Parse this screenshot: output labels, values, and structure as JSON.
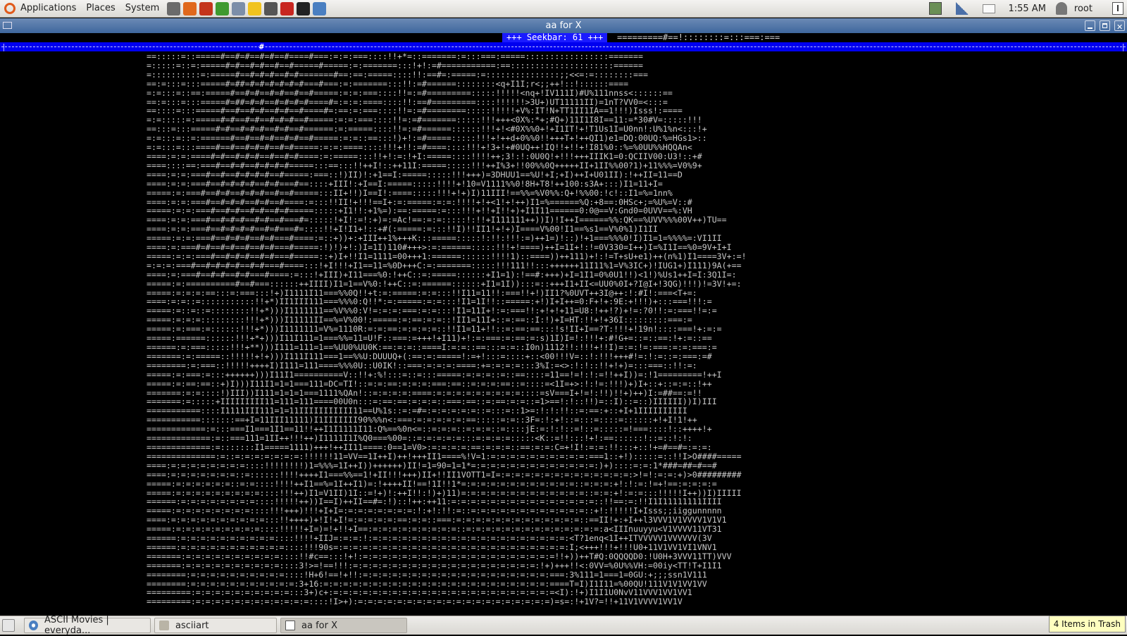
{
  "top_panel": {
    "menus": [
      "Applications",
      "Places",
      "System"
    ],
    "launchers": [
      {
        "icon": "evolution-icon",
        "color": "#6b6b6b"
      },
      {
        "icon": "firefox-icon",
        "color": "#e0681c"
      },
      {
        "icon": "tools-icon",
        "color": "#c4341b"
      },
      {
        "icon": "refresh-icon",
        "color": "#3f9a2f"
      },
      {
        "icon": "network-icon",
        "color": "#7c8ea8"
      },
      {
        "icon": "smiley-icon",
        "color": "#f1c31e"
      },
      {
        "icon": "text-editor-icon",
        "color": "#555555"
      },
      {
        "icon": "filezilla-icon",
        "color": "#c8261f"
      },
      {
        "icon": "terminal-icon",
        "color": "#222222"
      },
      {
        "icon": "chromium-icon",
        "color": "#4a7fc1"
      }
    ],
    "clock": "1:55 AM",
    "user": "root"
  },
  "window": {
    "title": "aa for X"
  },
  "terminal": {
    "status_left": "::::::::=========#=#=#==#=#==#======:=:===:::::!+*)+!:==#",
    "seekbar_label": "+++ Seekbar: 61 +++",
    "status_right": "=========#==!::::::::=:::===:===",
    "seekbar_percent": 23,
    "ascii_lines": [
      "==:::::=::=====#==#=#==#=#==#====#===:=:=:===::::!!+*=::=======:=:::===:=====:::::::::::::::::=======",
      "=:::::=::=:=====#=#==#=#==#==#=====#=====:=:=======:::!+!:=#===========:==:::::::::::::::::::::======",
      "=::::::::::=:=====#==#=#=#==#=#=======#==:==:=====::::!!:==#=:=====:=:::::::::::::::;;<<=:=::::::::===",
      "==:=:::=:::=====#=##=#=#=#=#=#=#===#===:=:=======:::!!:=#======::::::::<q+I1I;r<;;++!::!::::::====",
      "=:=:::=::==:=====#==#=#==#=#==#==#=====:=:=:===::::!!=:=#=========:::::!!!!!<nq+!IV111I)#U%111nnss<::::::==",
      "==:=:::=:::=====#=##=#=#==#=#=#=#====#=:=:=:====::::!!:==#=========::::!!!!!!>3U+)UT11111II)=1nT?VV0=<:::=",
      "==::::=:::=====#==#==#=#==#=#==#====#=:==:=:===::::!!=:=#========:::::!!!!!+V%:IT!N+TT1II1IA==1!!!)Isss!:====",
      "=:=:::::=:=====#=#==#=#==#=#=#==#=====:=:=:===::::!!=:=#=======:::::!!!+++<0X%:*+;#Q+)11I1I8I==11:=*30#V=:::::!!!",
      "==:::=:::=====#=#==#=#=#==#=#==#======:=:=====::::!!=:=#======::::::!!!+!<#0X%%0+!+I1IT!+!T1Us1I=U0nn!:U%1%n<:::!+",
      "=:=:::=::=:======#==#==#=#==#=#==#=====:=:=::==:::!)+!:=#=====:::::!!!+!++d+0%%0!!+++T+!++QI1)e1=DQ:00UQ:%=HGs1>::",
      "=:=:::=:::====#==#==#=#=#==#=#=====:=:=:====::::!!!+!!:=#====::::!!!+!3+!+#0UQ++!IQ!!+!!+!I81%0::%=%0UU%%HQQAn<",
      "====:=:=:====#=#==#=#=#==#==#=#====:=:=====:::!!+!:=:!+I:=====::::!!!!++;3!:!:0U0Q!+!!!+++IIIK1=0:QCIIV00:U3!::+#",
      "====::::==:===#==#=#==#=#=#=#=====:::==:::!!++I!::++11I:=====:::::!!!++I%3+!!00%%0Q+++++II+1II%%00?1)+11%%%=V0%9+",
      "====:=:=:===#==#==#=#=#=#==#=====:===::!)II)!:+1==I:=====:::::!!!+++)=3DHUU1==%U!+I;+I)++I+U01II):!++II=11==D",
      "====:=:=:===#==#=#=#=#==#=#===#==::::+III!:+I==I:=====:::::!!!!+!10=V1111%%0!8H+T8!++100:s3A+:::)I1=11+I=",
      "=====:=:===#==#=#==#=#=#==#==#=====:::II+!!)I==I!:====:::::!!!+!+)I)11III!==%%=%V0%%:Q+!%%00:!c!::I1=%=1nn%",
      "====:=:=:===#==#=#=#==#=#==#====:=:::!!II!+!!!==I+:=:=====:=:=:!!!!+!+<1!+!++)I1=%======%Q:+8==:0HSc+;=%U%=V::#",
      "=====:=:=:===#==#=#==#=#==#=#=====:::::+I1!!:+1%=):==:=====:=:::!!!+!!+I!!+)+I1I11======0:0@==V:Gnd0=0UVV==%:VH",
      "====:=:=:===#==#=#=#==#=#==#===#=:::::!+I!:=!:+)=:=Ac!==:=:=:::::!:!!+I111111++))I)!I++I======%%:QK==%UVV%%%00V++)TU==",
      "====:=:=:===#==#=#=#=#==#=#===#=::::!!+I!I1+!::+#(:=====:=:::!!I)!!II1!+!+)I====V%00!I1==%s1==V%0%1)I1II",
      "=====:=:=:===#==#=#=#==#=#===#====:=::+))+:+III++1%+++K:::=====:::::!:!!:!!!:=)++1=)!::)!+1===%%%0!I)I1=1=%%%%=:VI1II",
      "====:=:===#=#==#=#==#==#=#===#=====:!)!)+!:)I=1I)110#+++>:=:======:::::!!!+!====)++I=1I+!:!=0V330=I++)I=%I1I==%0=9V+I+I",
      "=====:=:=:===#==#=#=#==#=#===#=====::+)I+!!I1=1111=00+++1:======::::::!!!!1)::====))++111)+!:!=T+sU+e1)++(n%1)I1====3V+:=!",
      "=:=:=:===#==#=#=#=#==#=#===#====:::!+I!!!+I1==11=%0D+++C:=:=======:::::!!!111!!:::++++++11I11%1=V%3IC+)!IUG1+)I111)9A(+==",
      "====:=:===#==#=#==#=#===#====:=:::!+III)+I11===%0:!++C::=:=====::::::+I1=1):!==#:+++)+I=1I1=0%0U1!!)<1!)%Us1++I=I:3Q1I=:",
      "=====:=:==========#==#===::::::++IIII)I1=1==V%0:!++C::=:======::::::+I1=1I)):::=::+++I1+II<=UU0%0I+?I@I+!3QG)!!!)!=3V!+=:",
      "=====:=:=:=:==:::=:===:::!+)I1111I11===%%0Q!!+t:=:=====:=:=:::!!I11=11!!:===!!+!)II1?%0UVT++3I@++:!:#I!:===<T+=:",
      "====:=:=::=:::::::::::!!+*)II1III111===%%%0:Q!!*:=:=====:=:=:::!I1=1I!!::=====:+!)I+I++=0:F+!+:9E:+!!!)+:::===!!!:=",
      "=====:=::=::=::::::::!!+*)))I1111111==%V%%0:V!=:=:=:===:=:=:::!I1=11I+!:=:===!!:+!+!+11=U8:!++!?)+!=:?0!!:=:===!!=:=",
      "=====:=:=:=:::::::::!!!+*)))I11111II==%=V%00!:=====:=:==:=:=::!II1=11I+::=:==::I:!)+I=HT:!!+!+36I:::::::::===:=",
      "=====:=:===:=::::::!!!+*)))I1111111=V%=1110R:=:=:==:=:=:=:=::!!I1=11+!!::=:==:==:::!s!II+I==?T:!!!+!19n!::::===!+:=:=",
      "=====:======::::::!!!+*+)))I11I111=1===%%=11=U!F::===:=+++!+I11)+!:=:===:=:==:=:s)1I)I=!:!!!+:#!G+=::=::==:!+:=::==",
      "======:=:===:::::!!!+**)))I111=111=1==%UU0%UU0K:==:=:=::====I:=:=::==:::=:=::I0n)1112!!:!!!+!!I)=:=:!=:===:=:=:===:=",
      "=======:=:=====::!!!!!+!+)))I111I111===1==%%U:DUUUQ+(:==:=:=====!:=+!:::=::::+::<00!!!V=::!:!!!+++#!=:!:=::=:===:=#",
      "========:=:===::!!!!!++++I)I111=111====%%%0U::U0IK!::===:=:=:=:====:+=:=:=:=:::3%I:=<>:!:!::!!+!+)=:::===::!!:=:",
      "=====:=:===:=:::++++++)))I11I1==========V::!!+:%!:::=::=:::=====:=:=:=::=::==::::=11==!=!:!:=!!++I))=:!1=========!++I",
      "=====:=:==:==::+)I)))I11I1=1=1===111=DC=TI!::=:=:==:=:=:=:===:==::=:=:=:==::=::::=<1I=+>:!:!=:!!!)+)I+::+::=:=::!++",
      "=======:=:=::::!)III))I111=1=1=1===1111%QAn!::=:=:=:=:====:=:=:=:=:=:=:=:=:=::::=sV===I+!=!:!!)!!+)++)I:=##==:=!!",
      "=======:=:::::+IIIIIIIII11=111=111====00U0n:::=:==:==:=:=:=::===:==::=:==:=:=::=1>==!:!::!!)=::I)::=::)IIIIII))I)III",
      "===========::::I1111III111=1=11IIIIIIIIIII11==U%1s::=:=#=:=:=:=:=:=::=:::=::1>=:!:!:!!::=:==:+::+I+1IIIIIIIIII",
      "===========:::::::==+I=11III11111)I1IIIIIII90%%%n<:===:=:=:=:=:=:==:::::=:=::3F=:!:+!::=:::=::::=::::::+!+I!1!++",
      "============:=:::===I1===1I1==11!!++I1I1111I11:Q%==%0n<=::=:=:=::=:=:=::=::::jE:=:!:!::=!::=:::::=!===::::!::++++!+",
      "=============:=::===111=1II++!!!++)I1111I1I%Q0===%00=::=:=:=:=:=:::=:=:=:=:::::<K::=!!:::!+!:==::::::!::=::!:!:",
      "=============:=:::::::I1=====1111)+++!++II11====:0==1=V0>:=:=:=:=:==:=:=:=::==:=:=:C=+!I!:=:=:!!:::+::!+=#==#=:=:=:",
      "==============:=::=:=:=:=:=:=:=:!!!!!!11=VV==1I++I)++!+++II1====%!V=1:=:=:=:=:=:=:=:=:=:=:===1::+!):::::=::!!I>O####=====",
      "====:=:=:=:=:=:=:=:=::::!!!!!!!!)1=%%%=1I++I))++++++)II!=1=90=1=1*=:=:=:=:=:=:=:=:=:=:=:=:=:)+)::::=:=:1*###=##=#==#",
      "====:=:=:=:=:=:=:=::=::::::!!!!++++I1===%%==1!+II!!!+++)II+!!II1VOTT1=I=:=:=:=:=:=:=:=:=:=:=:=:=:=:>!=!:=:=:+)>0#########",
      "=====:=:=:=:=:=:=::=:=::::!!!!++I1==%=1I++I1)=:!++++II!==!1I!!1*=:=:=:=:=:=:=:=:=:=:=:=::=:=:=:+!:!:=:!=+!==:=:=:=:=",
      "=====:=:=:=:=:=:=:=:=:=::::!!!++)I1=V1II)1I::=!+)!:++I!!:!)+)11)=:=:=:=:=:=:=:=:=:=:=:=:=::=:=:+!:=:=:::!!!!!I++))I)IIIII",
      "======:=:=:=:=:=:=:=:=::::!!!!!++))I==I)++II==#=:!)::!++:++11:=:=:=:=:=:=:=:=:=:=:=:=:=:=:=::!!==:=:!!I1I11111111IIII",
      "=====:=:=:=:=:=:=:=:=::::!!!+++)!!!+I+I=:=:=:=:=:=:=:=:!:+!:!!:=::=:=:=:=:=:=:=:=:=:=:=:=::+!:!!!!!I+Isss;;iiggunnnnn",
      "====:=:=:=:=:=:=:=:=:=:=:::!!++++)+!I!+I!=:=:=:=:=:==:=:=::===:=:=:=:=:=:=:=:=:=:=:=:=:=::==II!+:+I++l3VVV1V1VVVV1V1V1",
      "=====:=:=:=:=:=:=:=:=:=::::!!!!!+I=)=!+!!+I==:=:=:=:=:=:=:=:=:=::=:=:=:=:=:=:=:=:=:=:=:=:=:=:a<IIInuuyyu<V1VVVV11VT31",
      "======:=:=:=:=:=:=:=:=:=:=::::!!!!+IIJ=:=:=:!:=:=:=:=:=:=:=:=:=:=:=:=:=:=:=:=:=:=:=:=:<T?1enq<1I++ITVVVVV1VVVVVV(3V",
      "======:=:=:=:=:=:=:=:=:=:=:=::::!!!90s=:=:=:=:=:=:=:=:=:=:=:=:=:=:=:=:=:=:=:=:=:=:=:=:I;<+++!!!+!!!U0+11V1VV1VI1VNV1",
      "=======:=:=:=:=:=:=:=:=:=:=::::!!#c==:::!+!:=:=:=:=:=:=:=:=:=:=:=:=:=:=:=:=:=:=:=:=!!+))++T#Q:0QQQQD0:!U0H+3VVV11TT)VVV",
      "=======:=:=:=:=:=:=:=:=:=:=::::3!>=!==!!!:=:=:=:=:=:=:=:=:=:=:=:=:=:=:=:=:=:=:=:!+)+++!!<:0VV=%0U%%VH:=00iy<TT!T+I1I1",
      "========:=:=:=:=:=:=:=:=:=:=::::!H+6!==!+!!:=:=:=:=:=:=:=:=:=:=:=:=:=:=:=:=:=:=:=:===:3%111=1===1=0GU:+;;;ssn1V111",
      "========:=:=:=:=:=:=:=:=:=:=:=:3+16:=:=:=:=:=:=:=:=:=:=:=:=:=:=:=:=:=:=:=:=:=:=:=:====T=I)I1I11=%00QU!111V1V1VV1VV",
      "=========:=:=:=:=:=:=:=:=:=:=:::3+)c+:=:=:=:=:=:=:=:=:=:=:=:=:=:=:=:=:=:=:=:=:=:=:=<I):!+)I1I1U0NvV11VVV1VV1VV1",
      "=========:=:=:=:=:=:=:=:=:=:=:=:=::::!I>+):=:=:=:=:=:=:=:=:=:=:=:=:=:=:=:=:=:=:=:=)=s=:!+1V?=!!+11V1VVVV1VV1V"
    ]
  },
  "taskbar": {
    "tasks": [
      {
        "label": "ASCII Movies | everyda...",
        "icon": "chromium-icon"
      },
      {
        "label": "asciiart",
        "icon": "folder-icon"
      },
      {
        "label": "aa for X",
        "icon": "terminal-window-icon"
      }
    ],
    "trash_tooltip": "4 Items in Trash"
  },
  "colors": {
    "terminal_bg": "#000000",
    "seekbar_bg": "#0000f0",
    "titlebar": "#4d73a8",
    "ascii_fg": "#c8c8c8"
  }
}
